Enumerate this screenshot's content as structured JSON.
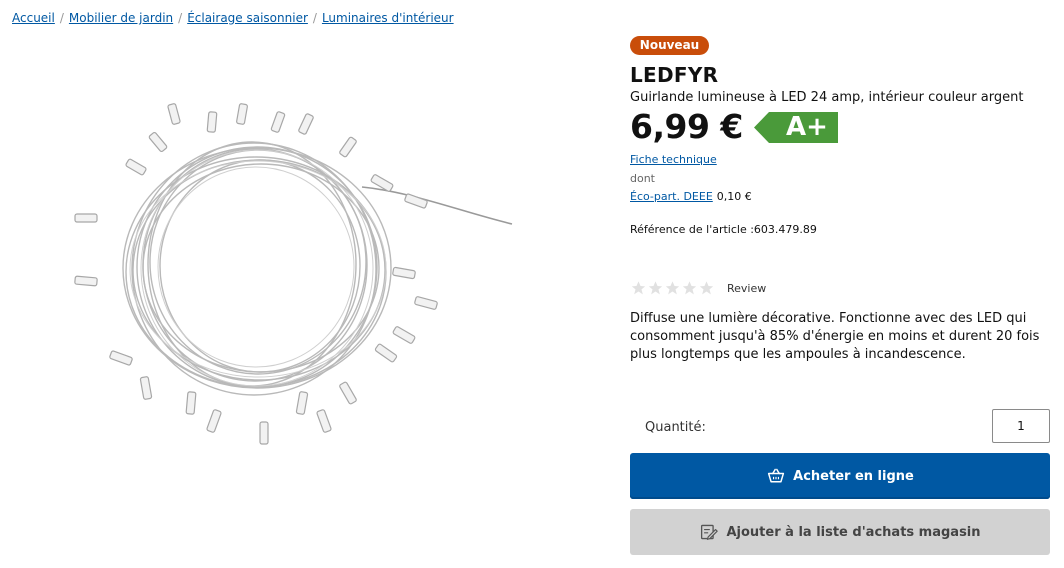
{
  "breadcrumb": [
    {
      "label": "Accueil"
    },
    {
      "label": "Mobilier de jardin"
    },
    {
      "label": "Éclairage saisonnier"
    },
    {
      "label": "Luminaires d'intérieur"
    }
  ],
  "product": {
    "badge": "Nouveau",
    "name": "LEDFYR",
    "subtitle": "Guirlande lumineuse à LED 24 amp, intérieur couleur argent",
    "price": "6,99 €",
    "energy_class": "A+",
    "energy_color": "#4a9a3a",
    "fiche_label": "Fiche technique",
    "dont_label": "dont",
    "eco_label": "Éco-part. DEEE",
    "eco_value": "0,10 €",
    "reference": "Référence de l'article :603.479.89",
    "rating": {
      "stars": 0,
      "max": 5,
      "label": "Review"
    },
    "description": "Diffuse une lumière décorative. Fonctionne avec des LED qui consomment jusqu'à 85% d'énergie en moins et durent 20 fois plus longtemps que les ampoules à incandescence."
  },
  "purchase": {
    "quantity_label": "Quantité:",
    "quantity_value": "1",
    "buy_label": "Acheter en ligne",
    "list_label": "Ajouter à la liste d'achats magasin"
  },
  "colors": {
    "badge": "#c94d0a",
    "primary": "#0058a3",
    "secondary_button": "#d2d2d2"
  },
  "icons": [
    "cart-icon",
    "shopping-list-icon",
    "star-icon"
  ]
}
